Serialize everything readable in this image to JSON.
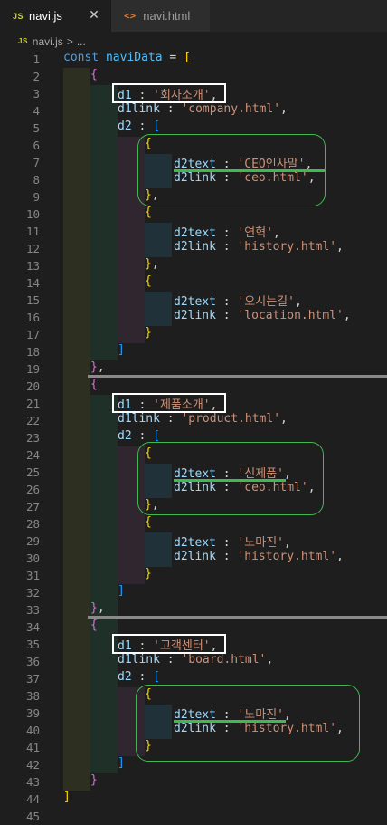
{
  "tabs": [
    {
      "label": "navi.js",
      "badge": "JS",
      "active": true,
      "close": "✕"
    },
    {
      "label": "navi.html",
      "badge": "<>",
      "active": false
    }
  ],
  "breadcrumb": {
    "file_badge": "JS",
    "file": "navi.js",
    "separator": ">",
    "more": "..."
  },
  "colors": {
    "keyword": "#569cd6",
    "variable": "#4fc1ff",
    "property": "#9cdcfe",
    "string": "#ce9178",
    "bracket_gold": "#ffd700",
    "bracket_purple": "#da70d6",
    "bracket_blue": "#179fff",
    "highlight_box": "#ffffff",
    "annotation_green": "#3fb950"
  },
  "code": {
    "line_numbers": [
      "1",
      "2",
      "3",
      "4",
      "5",
      "6",
      "7",
      "8",
      "9",
      "10",
      "11",
      "12",
      "13",
      "14",
      "15",
      "16",
      "17",
      "18",
      "19",
      "20",
      "21",
      "22",
      "23",
      "24",
      "25",
      "26",
      "27",
      "28",
      "29",
      "30",
      "31",
      "32",
      "33",
      "34",
      "35",
      "36",
      "37",
      "38",
      "39",
      "40",
      "41",
      "42",
      "43",
      "44",
      "45"
    ],
    "l1": {
      "kw": "const",
      "name": "naviData",
      "eq": " = ",
      "br": "["
    },
    "l2": {
      "br": "{"
    },
    "l3": {
      "key": "d1",
      "sep": " : ",
      "val": "'회사소개'",
      "end": ","
    },
    "l4": {
      "key": "d1link",
      "sep": " : ",
      "val": "'company.html'",
      "end": ","
    },
    "l5": {
      "key": "d2",
      "sep": " : ",
      "br": "["
    },
    "l6": {
      "br": "{"
    },
    "l7": {
      "key": "d2text",
      "sep": " : ",
      "val": "'CEO인사말'",
      "end": ","
    },
    "l8": {
      "key": "d2link",
      "sep": " : ",
      "val": "'ceo.html'",
      "end": ","
    },
    "l9": {
      "br": "}",
      "end": ","
    },
    "l10": {
      "br": "{"
    },
    "l11": {
      "key": "d2text",
      "sep": " : ",
      "val": "'연혁'",
      "end": ","
    },
    "l12": {
      "key": "d2link",
      "sep": " : ",
      "val": "'history.html'",
      "end": ","
    },
    "l13": {
      "br": "}",
      "end": ","
    },
    "l14": {
      "br": "{"
    },
    "l15": {
      "key": "d2text",
      "sep": " : ",
      "val": "'오시는길'",
      "end": ","
    },
    "l16": {
      "key": "d2link",
      "sep": " : ",
      "val": "'location.html'",
      "end": ","
    },
    "l17": {
      "br": "}"
    },
    "l18": {
      "br": "]"
    },
    "l19": {
      "br": "}",
      "end": ","
    },
    "l20": {
      "br": "{"
    },
    "l21": {
      "key": "d1",
      "sep": " : ",
      "val": "'제품소개'",
      "end": ","
    },
    "l22": {
      "key": "d1link",
      "sep": " : ",
      "val": "'product.html'",
      "end": ","
    },
    "l23": {
      "key": "d2",
      "sep": " : ",
      "br": "["
    },
    "l24": {
      "br": "{"
    },
    "l25": {
      "key": "d2text",
      "sep": " : ",
      "val": "'신제품'",
      "end": ","
    },
    "l26": {
      "key": "d2link",
      "sep": " : ",
      "val": "'ceo.html'",
      "end": ","
    },
    "l27": {
      "br": "}",
      "end": ","
    },
    "l28": {
      "br": "{"
    },
    "l29": {
      "key": "d2text",
      "sep": " : ",
      "val": "'노마진'",
      "end": ","
    },
    "l30": {
      "key": "d2link",
      "sep": " : ",
      "val": "'history.html'",
      "end": ","
    },
    "l31": {
      "br": "}"
    },
    "l32": {
      "br": "]"
    },
    "l33": {
      "br": "}",
      "end": ","
    },
    "l34": {
      "br": "{"
    },
    "l35": {
      "key": "d1",
      "sep": " : ",
      "val": "'고객센터'",
      "end": ","
    },
    "l36": {
      "key": "d1link",
      "sep": " : ",
      "val": "'board.html'",
      "end": ","
    },
    "l37": {
      "key": "d2",
      "sep": " : ",
      "br": "["
    },
    "l38": {
      "br": "{"
    },
    "l39": {
      "key": "d2text",
      "sep": " : ",
      "val": "'노마진'",
      "end": ","
    },
    "l40": {
      "key": "d2link",
      "sep": " : ",
      "val": "'history.html'",
      "end": ","
    },
    "l41": {
      "br": "}"
    },
    "l42": {
      "br": "]"
    },
    "l43": {
      "br": "}"
    },
    "l44": {
      "br": "]"
    }
  }
}
